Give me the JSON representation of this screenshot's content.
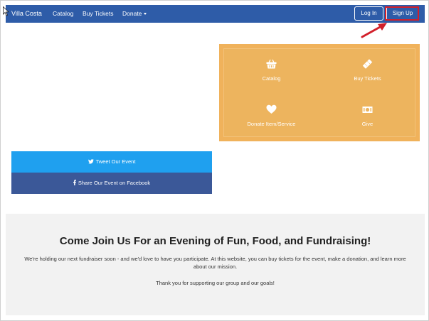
{
  "navbar": {
    "brand": "Villa Costa",
    "items": [
      {
        "label": "Catalog"
      },
      {
        "label": "Buy Tickets"
      },
      {
        "label": "Donate"
      }
    ],
    "login_label": "Log In",
    "signup_label": "Sign Up",
    "background_color": "#2e5ca8"
  },
  "actions": {
    "background_color": "#f0b25b",
    "items": [
      {
        "label": "Catalog",
        "icon": "basket-icon"
      },
      {
        "label": "Buy Tickets",
        "icon": "ticket-icon"
      },
      {
        "label": "Donate Item/Service",
        "icon": "heart-icon"
      },
      {
        "label": "Give",
        "icon": "money-icon"
      }
    ]
  },
  "share": {
    "twitter_label": "Tweet Our Event",
    "facebook_label": "Share Our Event on Facebook",
    "twitter_color": "#1fa0ef",
    "facebook_color": "#3b5898"
  },
  "info": {
    "title": "Come Join Us For an Evening of Fun, Food, and Fundraising!",
    "body": "We're holding our next fundraiser soon - and we'd love to have you participate. At this website, you can buy tickets for the event, make a donation, and learn more about our mission.",
    "thanks": "Thank you for supporting our group and our goals!"
  },
  "annotation": {
    "highlight_color": "#d21f2a",
    "target": "signup-button"
  }
}
